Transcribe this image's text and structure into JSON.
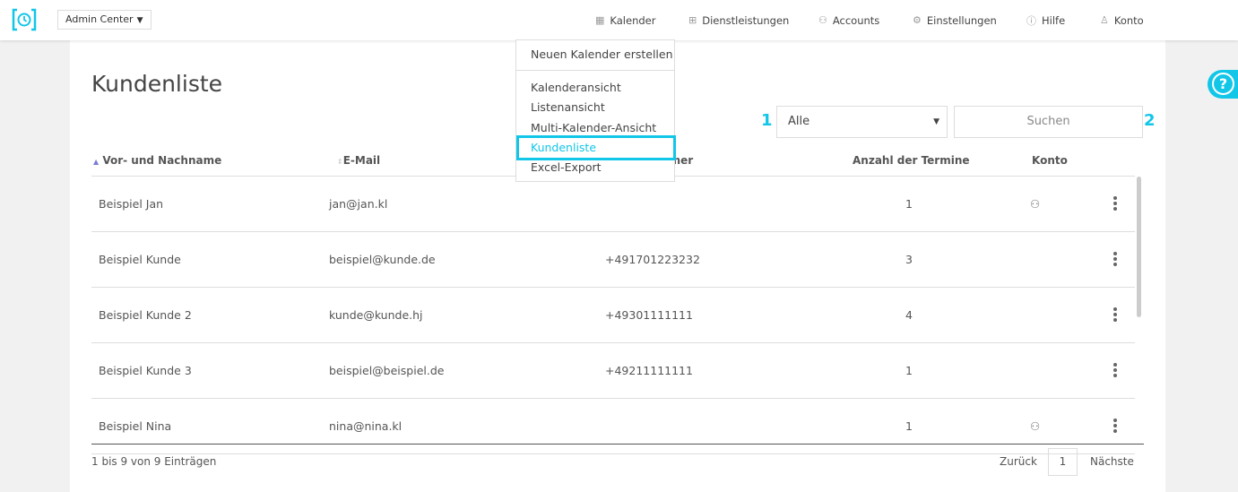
{
  "header": {
    "admin_label": "Admin Center",
    "nav": [
      {
        "label": "Kalender",
        "icon": "calendar-icon"
      },
      {
        "label": "Dienstleistungen",
        "icon": "grid-icon"
      },
      {
        "label": "Accounts",
        "icon": "users-icon"
      },
      {
        "label": "Einstellungen",
        "icon": "gear-icon"
      },
      {
        "label": "Hilfe",
        "icon": "question-icon"
      },
      {
        "label": "Konto",
        "icon": "user-icon"
      }
    ]
  },
  "dropdown": {
    "items": [
      "Neuen Kalender erstellen",
      "Kalenderansicht",
      "Listenansicht",
      "Multi-Kalender-Ansicht",
      "Kundenliste",
      "Excel-Export"
    ],
    "active": "Kundenliste"
  },
  "page": {
    "title": "Kundenliste",
    "marker1": "1",
    "marker2": "2",
    "filter_value": "Alle",
    "search_placeholder": "Suchen"
  },
  "table": {
    "columns": [
      "Vor- und Nachname",
      "E-Mail",
      "Telefonnummer",
      "Anzahl der Termine",
      "Konto"
    ],
    "rows": [
      {
        "name": "Beispiel Jan",
        "email": "jan@jan.kl",
        "phone": "",
        "count": "1",
        "account": true
      },
      {
        "name": "Beispiel Kunde",
        "email": "beispiel@kunde.de",
        "phone": "+491701223232",
        "count": "3",
        "account": false
      },
      {
        "name": "Beispiel Kunde 2",
        "email": "kunde@kunde.hj",
        "phone": "+49301111111",
        "count": "4",
        "account": false
      },
      {
        "name": "Beispiel Kunde 3",
        "email": "beispiel@beispiel.de",
        "phone": "+49211111111",
        "count": "1",
        "account": false
      },
      {
        "name": "Beispiel Nina",
        "email": "nina@nina.kl",
        "phone": "",
        "count": "1",
        "account": true
      }
    ]
  },
  "footer": {
    "info": "1 bis 9 von 9 Einträgen",
    "prev": "Zurück",
    "page": "1",
    "next": "Nächste"
  },
  "colors": {
    "accent": "#12c6e8"
  }
}
